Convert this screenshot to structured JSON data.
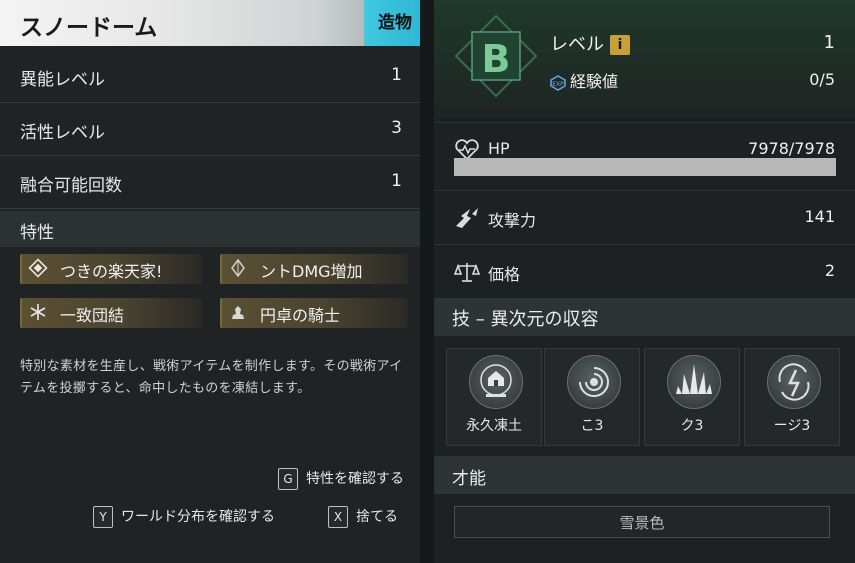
{
  "left_panel": {
    "title": "スノードーム",
    "type_tag": "造物",
    "stats": [
      {
        "label": "異能レベル",
        "value": "1"
      },
      {
        "label": "活性レベル",
        "value": "3"
      },
      {
        "label": "融合可能回数",
        "value": "1"
      }
    ],
    "traits_header": "特性",
    "traits": [
      {
        "name": "つきの楽天家!",
        "icon": "diamond-icon"
      },
      {
        "name": "ントDMG増加",
        "icon": "crystal-icon"
      },
      {
        "name": "一致団結",
        "icon": "snowflake-icon"
      },
      {
        "name": "円卓の騎士",
        "icon": "knight-icon"
      }
    ],
    "description": "特別な素材を生産し、戦術アイテムを制作します。その戦術アイテムを投擲すると、命中したものを凍結します。",
    "actions": [
      {
        "key": "G",
        "label": "特性を確認する"
      },
      {
        "key": "Y",
        "label": "ワールド分布を確認する"
      },
      {
        "key": "X",
        "label": "捨てる"
      }
    ]
  },
  "right_panel": {
    "rank": "B",
    "level_label": "レベル",
    "level_value": "1",
    "info_badge": "i",
    "exp_label": "経験値",
    "exp_value": "0/5",
    "hp_label": "HP",
    "hp_value": "7978/7978",
    "hp_fill": 1.0,
    "attack_label": "攻撃力",
    "attack_value": "141",
    "price_label": "価格",
    "price_value": "2",
    "skills_header": "技 – 異次元の収容",
    "skills": [
      {
        "label": "永久凍土",
        "icon": "snow-house-icon"
      },
      {
        "label": "こ3",
        "icon": "vortex-icon"
      },
      {
        "label": "ク3",
        "icon": "crystal-spikes-icon"
      },
      {
        "label": "ージ3",
        "icon": "lightning-swirl-icon"
      }
    ],
    "talent_header": "才能",
    "talent_value": "雪景色"
  },
  "colors": {
    "accent_cyan": "#2fb7d4",
    "trait_gold": "#5a5032",
    "rank_green": "#6fb88a",
    "info_gold": "#c8a03a"
  }
}
